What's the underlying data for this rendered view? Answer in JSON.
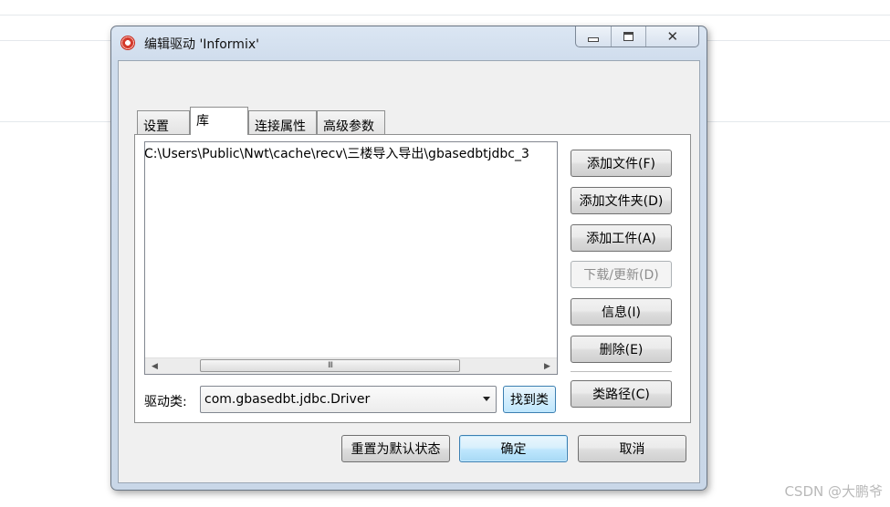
{
  "window": {
    "title": "编辑驱动 'Informix'",
    "tabs": [
      {
        "label": "设置",
        "active": false
      },
      {
        "label": "库",
        "active": true
      },
      {
        "label": "连接属性",
        "active": false
      },
      {
        "label": "高级参数",
        "active": false
      }
    ]
  },
  "library": {
    "files": [
      "C:\\Users\\Public\\Nwt\\cache\\recv\\三楼导入导出\\gbasedbtjdbc_3"
    ],
    "scroll_thumb": "III",
    "buttons": {
      "add_file": "添加文件(F)",
      "add_folder": "添加文件夹(D)",
      "add_artifact": "添加工件(A)",
      "download_update": "下载/更新(D)",
      "info": "信息(I)",
      "delete": "删除(E)",
      "classpath": "类路径(C)"
    },
    "driver_class_label": "驱动类:",
    "driver_class_value": "com.gbasedbt.jdbc.Driver",
    "find_class_button": "找到类"
  },
  "footer": {
    "reset_button": "重置为默认状态",
    "ok_button": "确定",
    "cancel_button": "取消"
  },
  "watermark": "CSDN @大鹏爷",
  "icons": {
    "app": "dbeaver-red-icon",
    "minimize": "minimize-icon",
    "maximize": "maximize-icon",
    "close": "close-icon"
  }
}
